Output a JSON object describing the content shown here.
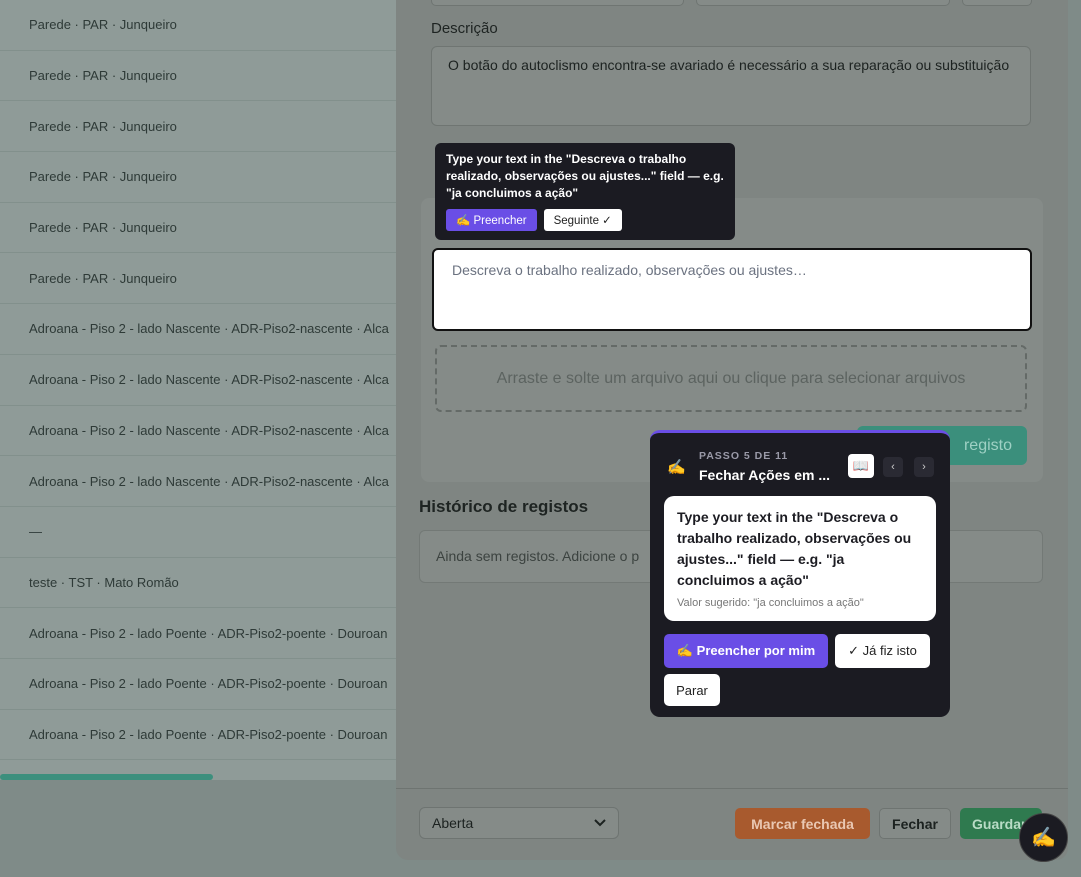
{
  "left_list": {
    "rows": [
      "Parede · PAR · Junqueiro",
      "Parede · PAR · Junqueiro",
      "Parede · PAR · Junqueiro",
      "Parede · PAR · Junqueiro",
      "Parede · PAR · Junqueiro",
      "Parede · PAR · Junqueiro",
      "Adroana - Piso 2 - lado Nascente · ADR-Piso2-nascente · Alca",
      "Adroana - Piso 2 - lado Nascente · ADR-Piso2-nascente · Alca",
      "Adroana - Piso 2 - lado Nascente · ADR-Piso2-nascente · Alca",
      "Adroana - Piso 2 - lado Nascente · ADR-Piso2-nascente · Alca",
      "—",
      "teste · TST · Mato Romão",
      "Adroana - Piso 2 - lado Poente · ADR-Piso2-poente · Douroan",
      "Adroana - Piso 2 - lado Poente · ADR-Piso2-poente · Douroan",
      "Adroana - Piso 2 - lado Poente · ADR-Piso2-poente · Douroan"
    ]
  },
  "drawer": {
    "description_label": "Descrição",
    "description_text": "O botão do autoclismo encontra-se avariado é necessário a sua reparação ou substituição",
    "notes_placeholder": "Descreva o trabalho realizado, observações ou ajustes…",
    "dropzone_text": "Arraste e solte um arquivo aqui ou clique para selecionar arquivos",
    "add_button_label": "registo",
    "history_title": "Histórico de registos",
    "history_empty": "Ainda sem registos. Adicione o p",
    "status_value": "Aberta",
    "mark_closed_label": "Marcar fechada",
    "close_label": "Fechar",
    "save_label": "Guardar"
  },
  "tooltip": {
    "text": "Type your text in the \"Descreva o trabalho realizado, observações ou ajustes...\" field — e.g. \"ja concluimos a ação\"",
    "fill_label": "✍ Preencher",
    "next_label": "Seguinte ✓"
  },
  "guide": {
    "step": "PASSO 5 DE 11",
    "title": "Fechar Ações em ...",
    "book_icon": "📖",
    "prev": "‹",
    "next": "›",
    "instruction": "Type your text in the \"Descreva o trabalho realizado, observações ou ajustes...\" field — e.g. \"ja concluimos a ação\"",
    "suggested": "Valor sugerido: \"ja concluimos a ação\"",
    "fill_label": "✍ Preencher por mim",
    "done_label": "✓ Já fiz isto",
    "stop_label": "Parar"
  },
  "colors": {
    "accent_purple": "#6a4ee6",
    "dark_panel": "#1b1b22",
    "green": "#3b8f7c",
    "orange": "#a85a2e"
  }
}
